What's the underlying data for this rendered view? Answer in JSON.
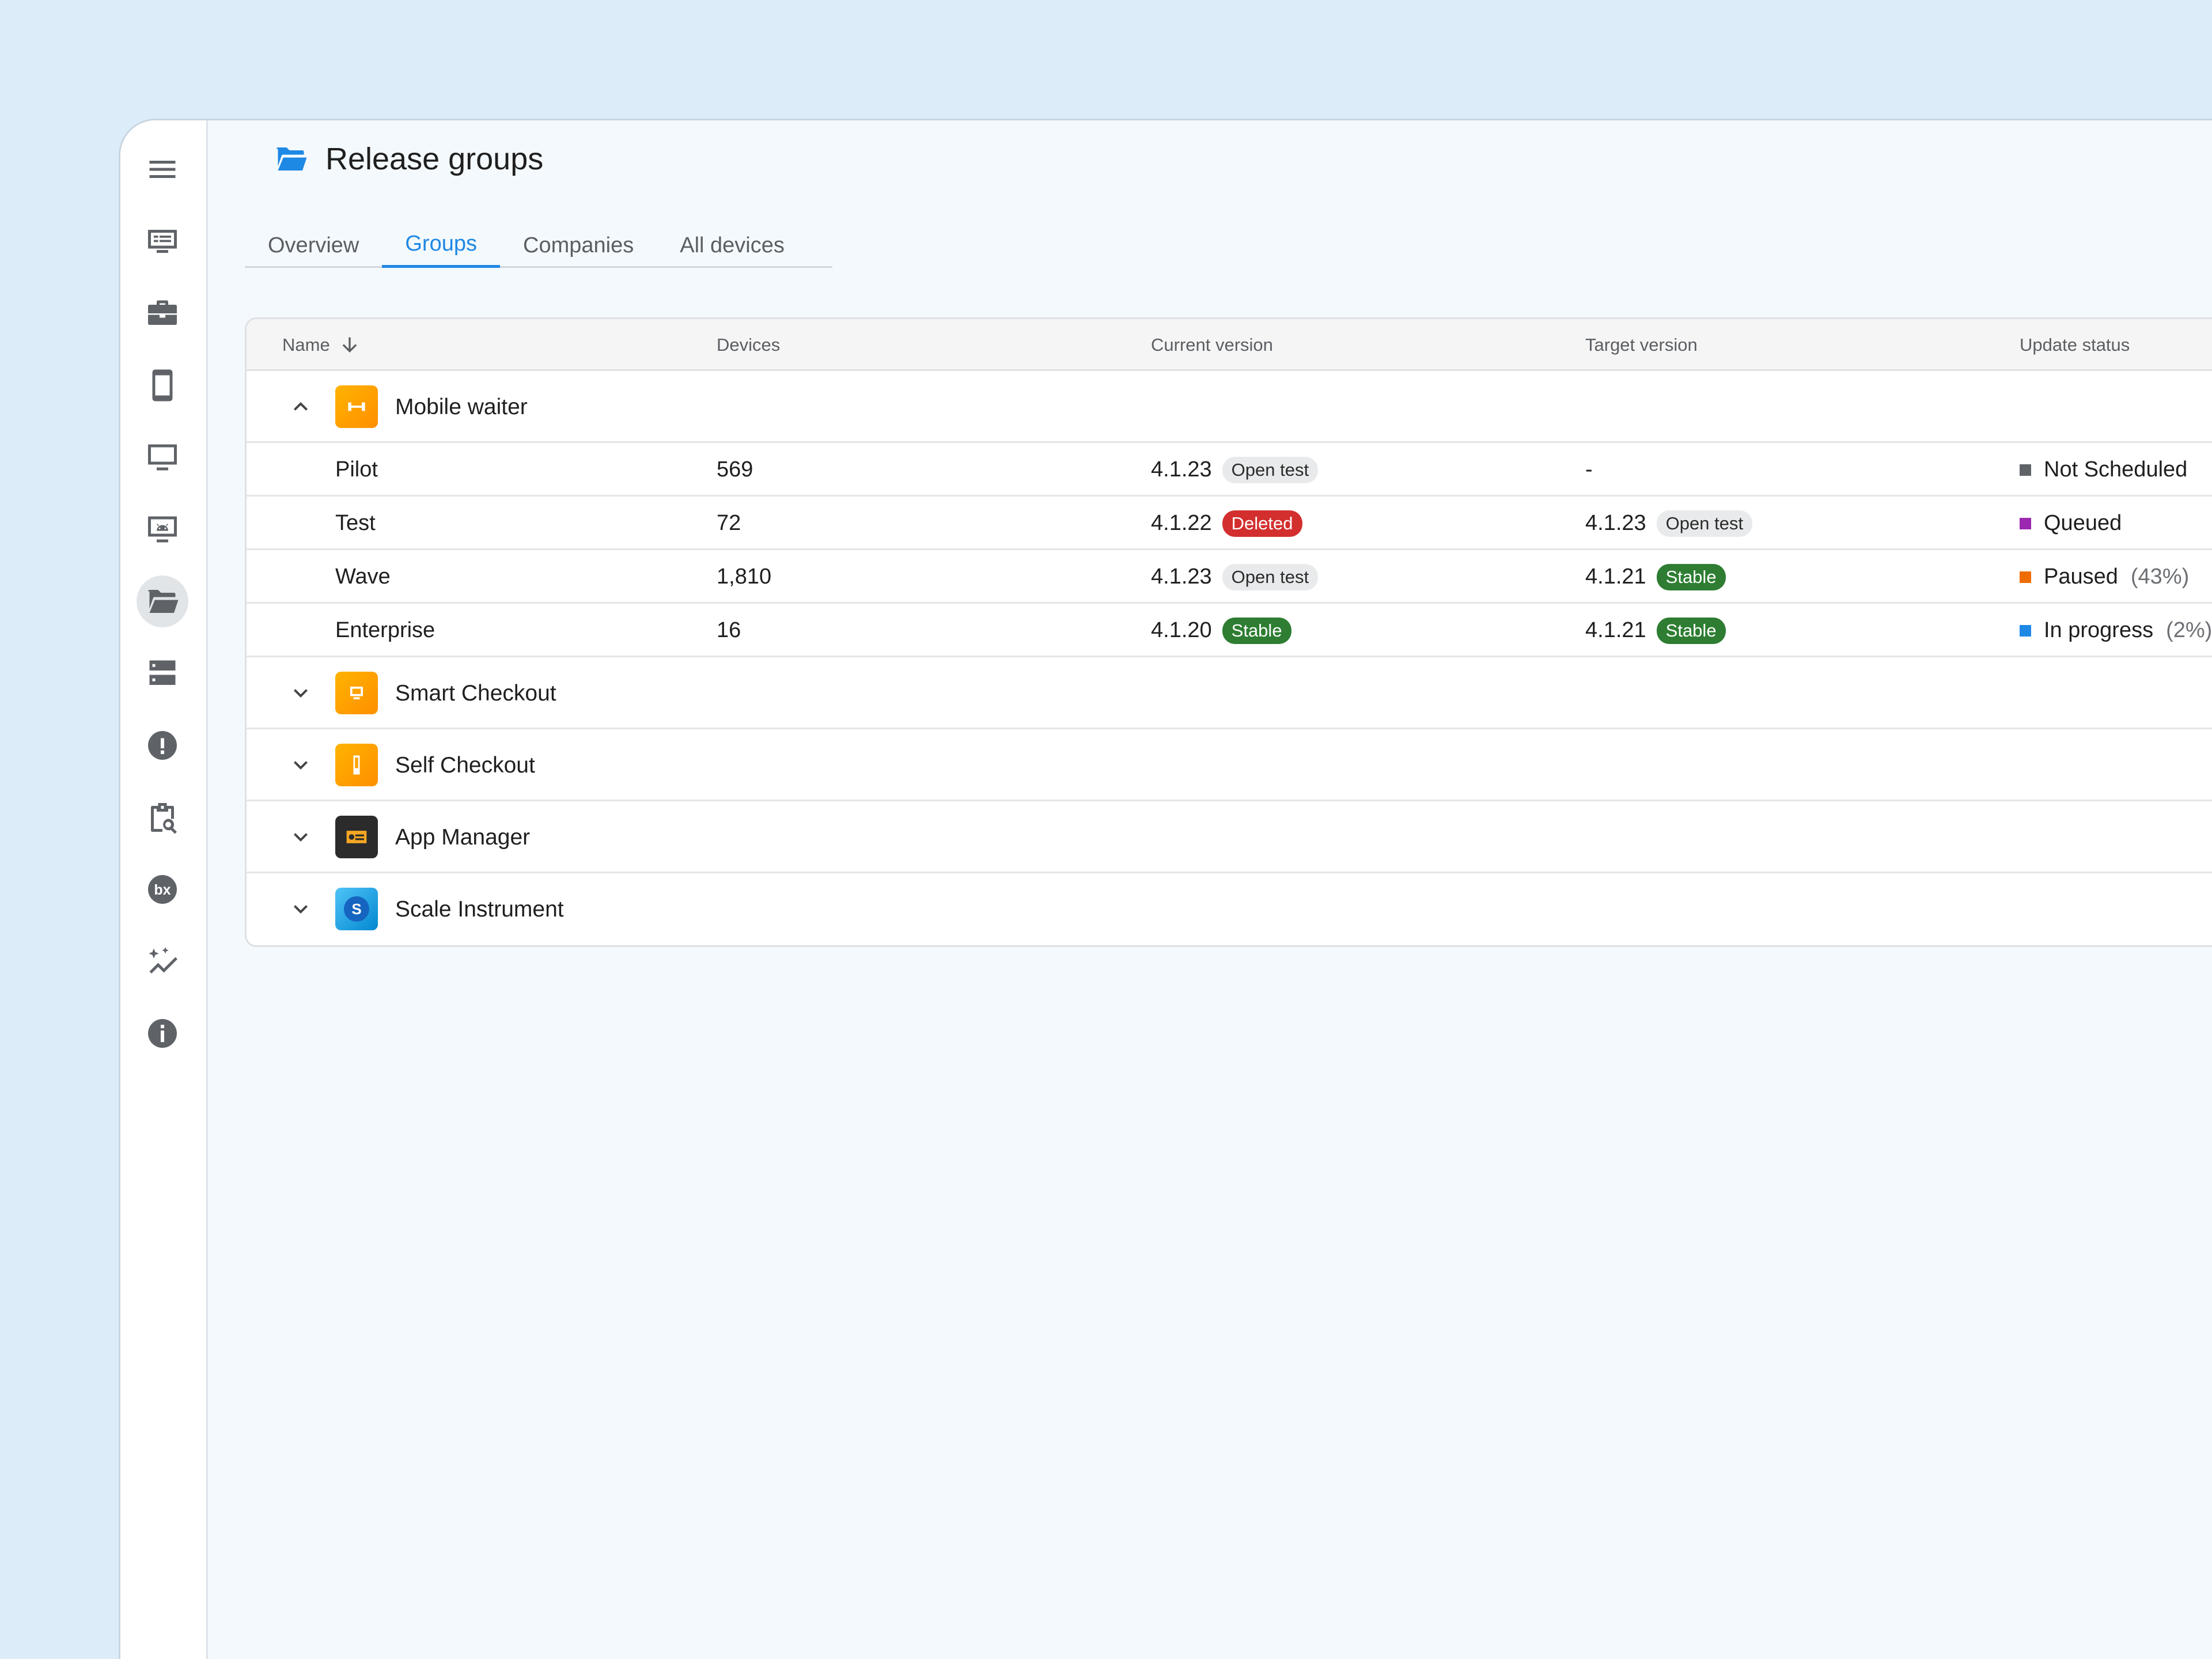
{
  "page": {
    "title": "Release groups",
    "title_icon": "folder-open-icon"
  },
  "sidebar": {
    "items": [
      {
        "icon": "menu-icon"
      },
      {
        "icon": "dashboard-list-icon"
      },
      {
        "icon": "briefcase-icon"
      },
      {
        "icon": "phone-icon"
      },
      {
        "icon": "monitor-icon"
      },
      {
        "icon": "android-monitor-icon"
      },
      {
        "icon": "folder-open-icon",
        "active": true
      },
      {
        "icon": "server-icon"
      },
      {
        "icon": "alert-icon"
      },
      {
        "icon": "clipboard-search-icon"
      },
      {
        "icon": "bx-icon"
      },
      {
        "icon": "sparkle-chart-icon"
      },
      {
        "icon": "info-icon"
      }
    ]
  },
  "tabs": [
    {
      "label": "Overview",
      "active": false
    },
    {
      "label": "Groups",
      "active": true
    },
    {
      "label": "Companies",
      "active": false
    },
    {
      "label": "All devices",
      "active": false
    }
  ],
  "table": {
    "headers": {
      "name": "Name",
      "devices": "Devices",
      "current": "Current version",
      "target": "Target version",
      "status": "Update status"
    },
    "expanded_group": {
      "name": "Mobile waiter",
      "rows": [
        {
          "name": "Pilot",
          "devices": "569",
          "current_version": "4.1.23",
          "current_badge": "Open test",
          "target_version": "-",
          "target_badge": "",
          "status": "Not Scheduled",
          "status_pct": "",
          "status_color": "#5f6368"
        },
        {
          "name": "Test",
          "devices": "72",
          "current_version": "4.1.22",
          "current_badge": "Deleted",
          "target_version": "4.1.23",
          "target_badge": "Open test",
          "status": "Queued",
          "status_pct": "",
          "status_color": "#9c27b0"
        },
        {
          "name": "Wave",
          "devices": "1,810",
          "current_version": "4.1.23",
          "current_badge": "Open test",
          "target_version": "4.1.21",
          "target_badge": "Stable",
          "status": "Paused",
          "status_pct": "(43%)",
          "status_color": "#ef6c00"
        },
        {
          "name": "Enterprise",
          "devices": "16",
          "current_version": "4.1.20",
          "current_badge": "Stable",
          "target_version": "4.1.21",
          "target_badge": "Stable",
          "status": "In progress",
          "status_pct": "(2%)",
          "status_color": "#1e88e5"
        }
      ]
    },
    "collapsed_groups": [
      {
        "name": "Smart Checkout"
      },
      {
        "name": "Self Checkout"
      },
      {
        "name": "App Manager"
      },
      {
        "name": "Scale Instrument",
        "icon_letter": "S"
      }
    ]
  }
}
